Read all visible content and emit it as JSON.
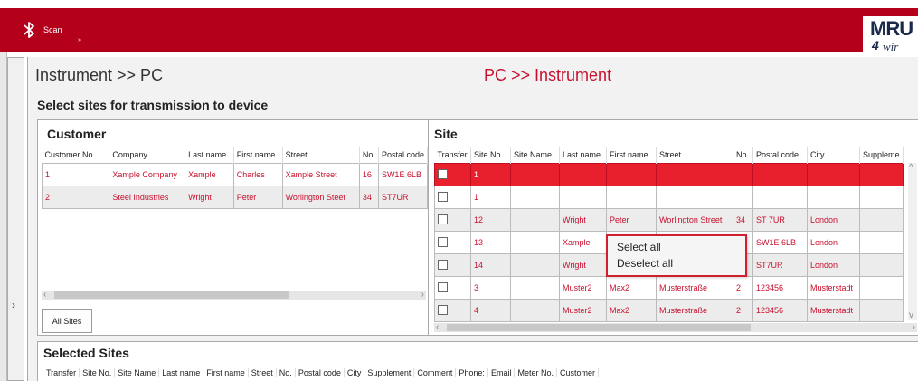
{
  "topbar": {
    "scan_label": "Scan",
    "scan_sub": "»",
    "logo_main": "MRU",
    "logo_num": "4",
    "logo_sub": "wir"
  },
  "headings": {
    "left": "Instrument >> PC",
    "right": "PC >> Instrument",
    "subtitle": "Select sites for transmission to device"
  },
  "customer": {
    "title": "Customer",
    "columns": [
      "Customer No.",
      "Company",
      "Last name",
      "First name",
      "Street",
      "No.",
      "Postal code"
    ],
    "rows": [
      [
        "1",
        "Xample Company",
        "Xample",
        "Charles",
        "Xample Street",
        "16",
        "SW1E 6LB"
      ],
      [
        "2",
        "Steel Industries",
        "Wright",
        "Peter",
        "Worlington Steet",
        "34",
        "ST7UR"
      ]
    ],
    "all_sites_button": "All Sites"
  },
  "site": {
    "title": "Site",
    "columns": [
      "Transfer",
      "Site No.",
      "Site Name",
      "Last name",
      "First name",
      "Street",
      "No.",
      "Postal code",
      "City",
      "Suppleme"
    ],
    "rows": [
      [
        "",
        "1",
        "",
        "",
        "",
        "",
        "",
        "",
        "",
        ""
      ],
      [
        "",
        "1",
        "",
        "",
        "",
        "",
        "",
        "",
        "",
        ""
      ],
      [
        "",
        "12",
        "",
        "Wright",
        "Peter",
        "Worlington Street",
        "34",
        "ST 7UR",
        "London",
        ""
      ],
      [
        "",
        "13",
        "",
        "Xample",
        "",
        "",
        "",
        "SW1E 6LB",
        "London",
        ""
      ],
      [
        "",
        "14",
        "",
        "Wright",
        "",
        "",
        "",
        "ST7UR",
        "London",
        ""
      ],
      [
        "",
        "3",
        "",
        "Muster2",
        "Max2",
        "Musterstraße",
        "2",
        "123456",
        "Musterstadt",
        ""
      ],
      [
        "",
        "4",
        "",
        "Muster2",
        "Max2",
        "Musterstraße",
        "2",
        "123456",
        "Musterstadt",
        ""
      ]
    ]
  },
  "context_menu": {
    "items": [
      "Select all",
      "Deselect all"
    ]
  },
  "selected_sites": {
    "title": "Selected Sites",
    "columns": [
      "Transfer",
      "Site No.",
      "Site Name",
      "Last name",
      "First name",
      "Street",
      "No.",
      "Postal code",
      "City",
      "Supplement",
      "Comment",
      "Phone:",
      "Email",
      "Meter No.",
      "Customer"
    ]
  },
  "colors": {
    "brand_red": "#b5001b",
    "selected_row": "#e8202e",
    "text_red": "#c8102e"
  },
  "icons": {
    "bluetooth": "bluetooth-icon",
    "collapse": "chevron-right-icon"
  }
}
